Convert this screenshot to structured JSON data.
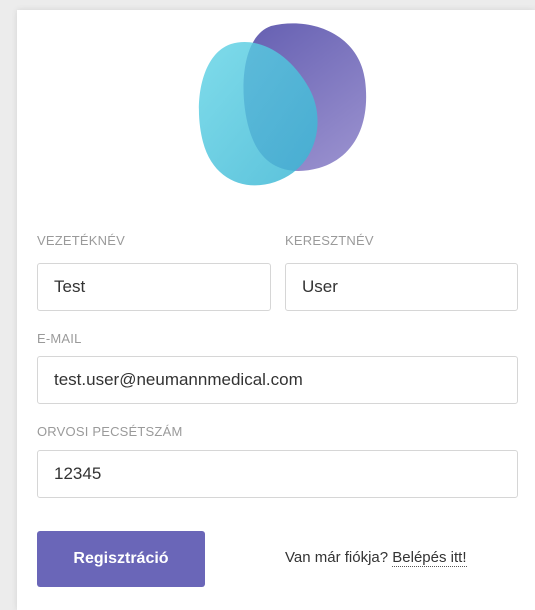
{
  "colors": {
    "primary": "#6a66b8",
    "logo_teal": "#4cc7dc",
    "logo_purple": "#6f65b6"
  },
  "logo": {
    "icon": "blob-logo-icon"
  },
  "form": {
    "last_name": {
      "label": "VEZETÉKNÉV",
      "value": "Test"
    },
    "first_name": {
      "label": "KERESZTNÉV",
      "value": "User"
    },
    "email": {
      "label": "E-MAIL",
      "value": "test.user@neumannmedical.com"
    },
    "stamp_number": {
      "label": "ORVOSI PECSÉTSZÁM",
      "value": "12345"
    }
  },
  "actions": {
    "register_label": "Regisztráció",
    "login_prompt": "Van már fiókja?",
    "login_link": "Belépés itt!"
  }
}
